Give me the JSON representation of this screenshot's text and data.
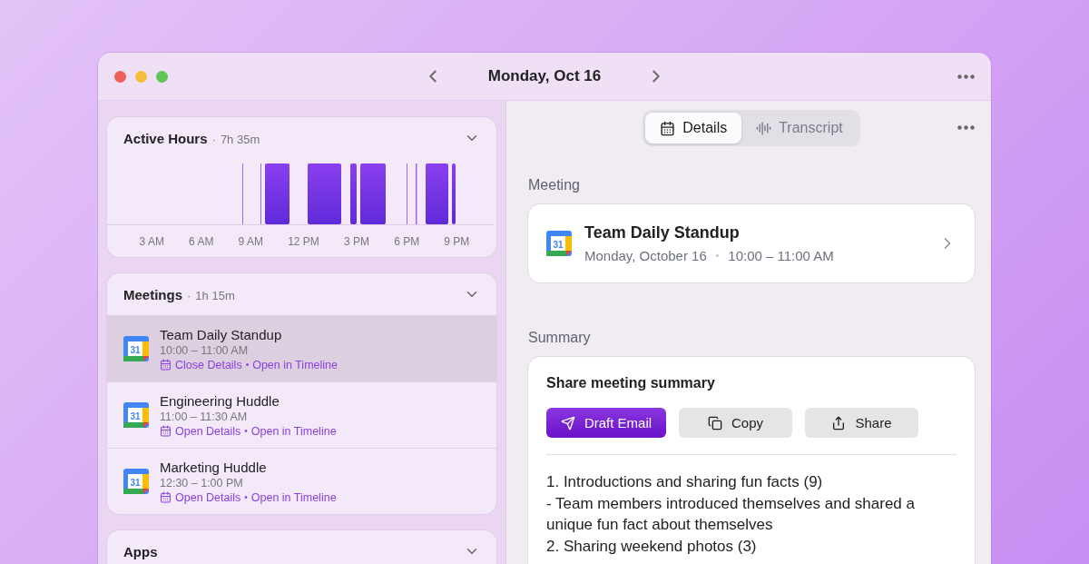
{
  "window": {
    "title": "Monday, Oct 16"
  },
  "sidebar": {
    "active_hours": {
      "title": "Active Hours",
      "separator": "·",
      "total": "7h 35m",
      "axis_labels": [
        "3 AM",
        "6 AM",
        "9 AM",
        "12 PM",
        "3 PM",
        "6 PM",
        "9 PM"
      ]
    },
    "meetings": {
      "title": "Meetings",
      "separator": "·",
      "total": "1h 15m",
      "items": [
        {
          "calendar_day": "31",
          "title": "Team Daily Standup",
          "time": "10:00 – 11:00 AM",
          "details_action": "Close Details",
          "separator": "•",
          "timeline_action": "Open in Timeline",
          "selected": true
        },
        {
          "calendar_day": "31",
          "title": "Engineering Huddle",
          "time": "11:00 – 11:30 AM",
          "details_action": "Open Details",
          "separator": "•",
          "timeline_action": "Open in Timeline",
          "selected": false
        },
        {
          "calendar_day": "31",
          "title": "Marketing Huddle",
          "time": "12:30 – 1:00 PM",
          "details_action": "Open Details",
          "separator": "•",
          "timeline_action": "Open in Timeline",
          "selected": false
        }
      ]
    },
    "apps": {
      "title": "Apps"
    }
  },
  "detail": {
    "tabs": [
      {
        "label": "Details",
        "selected": true
      },
      {
        "label": "Transcript",
        "selected": false
      }
    ],
    "meeting_heading": "Meeting",
    "meeting": {
      "calendar_day": "31",
      "title": "Team Daily Standup",
      "date": "Monday, October 16",
      "separator": "•",
      "time": "10:00 – 11:00 AM"
    },
    "summary_heading": "Summary",
    "summary": {
      "title": "Share meeting summary",
      "buttons": [
        {
          "kind": "email",
          "label": "Draft Email"
        },
        {
          "kind": "copy",
          "label": "Copy"
        },
        {
          "kind": "share",
          "label": "Share"
        }
      ],
      "lines": [
        "1. Introductions and sharing fun facts (9)",
        "- Team members introduced themselves and shared a unique fun fact about themselves",
        "2. Sharing weekend photos (3)"
      ]
    }
  }
}
